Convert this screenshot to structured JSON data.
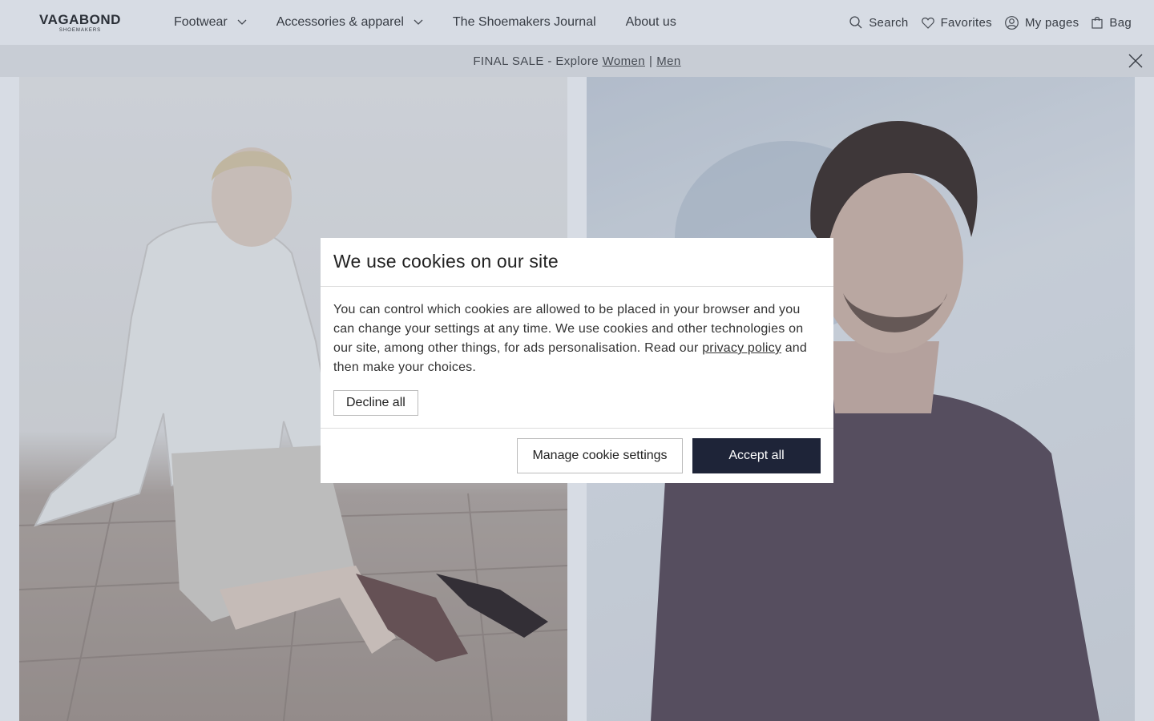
{
  "brand": {
    "name": "VAGABOND",
    "tagline": "SHOEMAKERS"
  },
  "nav": {
    "items": [
      {
        "label": "Footwear",
        "has_dropdown": true
      },
      {
        "label": "Accessories & apparel",
        "has_dropdown": true
      },
      {
        "label": "The Shoemakers Journal",
        "has_dropdown": false
      },
      {
        "label": "About us",
        "has_dropdown": false
      }
    ]
  },
  "utils": {
    "search": "Search",
    "favorites": "Favorites",
    "my_pages": "My pages",
    "bag": "Bag"
  },
  "promo": {
    "text": "FINAL SALE - Explore",
    "link_women": "Women",
    "separator": "|",
    "link_men": "Men"
  },
  "cookie_modal": {
    "title": "We use cookies on our site",
    "body_before_link": "You can control which cookies are allowed to be placed in your browser and you can change your settings at any time. We use cookies and other technologies on our site, among other things, for ads personalisation. Read our",
    "privacy_link": "privacy policy",
    "body_after_link": "and then make your choices.",
    "decline_label": "Decline all",
    "manage_label": "Manage cookie settings",
    "accept_label": "Accept all"
  },
  "colors": {
    "accent_button": "#1e2438",
    "overlay": "rgba(75,95,130,0.22)",
    "promo_bg": "#ececec"
  }
}
